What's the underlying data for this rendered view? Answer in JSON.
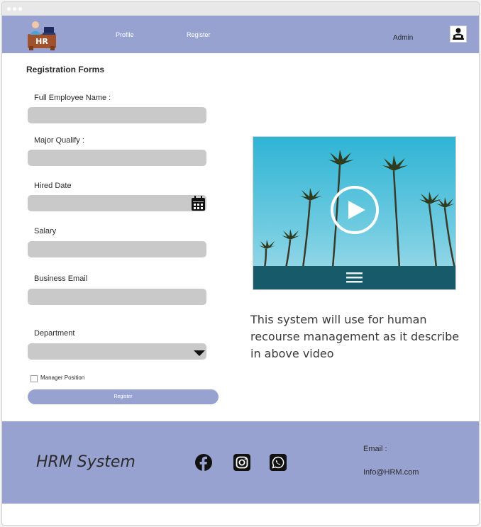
{
  "nav": {
    "logo_text": "HR",
    "links": [
      "Profile",
      "Register"
    ],
    "user": "Admin",
    "avatar_icon": "user-avatar-icon"
  },
  "form": {
    "title": "Registration Forms",
    "fields": [
      {
        "label": "Full Employee Name :",
        "value": ""
      },
      {
        "label": "Major Qualify :",
        "value": ""
      },
      {
        "label": "Hired Date",
        "value": "",
        "icon": "calendar-icon"
      },
      {
        "label": "Salary",
        "value": ""
      },
      {
        "label": "Business Email",
        "value": ""
      },
      {
        "label": "Department",
        "value": "",
        "icon": "dropdown-caret-icon"
      }
    ],
    "checkbox_label": "Manager Position",
    "checkbox_checked": false,
    "submit_label": "Register"
  },
  "media": {
    "video_icon": "play-icon",
    "menu_icon": "hamburger-menu-icon",
    "description": "This system will use for human recourse management as it describe in above video"
  },
  "footer": {
    "brand": "HRM System",
    "social_icons": [
      "facebook-icon",
      "instagram-icon",
      "whatsapp-icon"
    ],
    "email_label": "Email :",
    "email_value": "Info@HRM.com"
  },
  "colors": {
    "accent": "#97a2d1",
    "field": "#c9c9c9"
  }
}
